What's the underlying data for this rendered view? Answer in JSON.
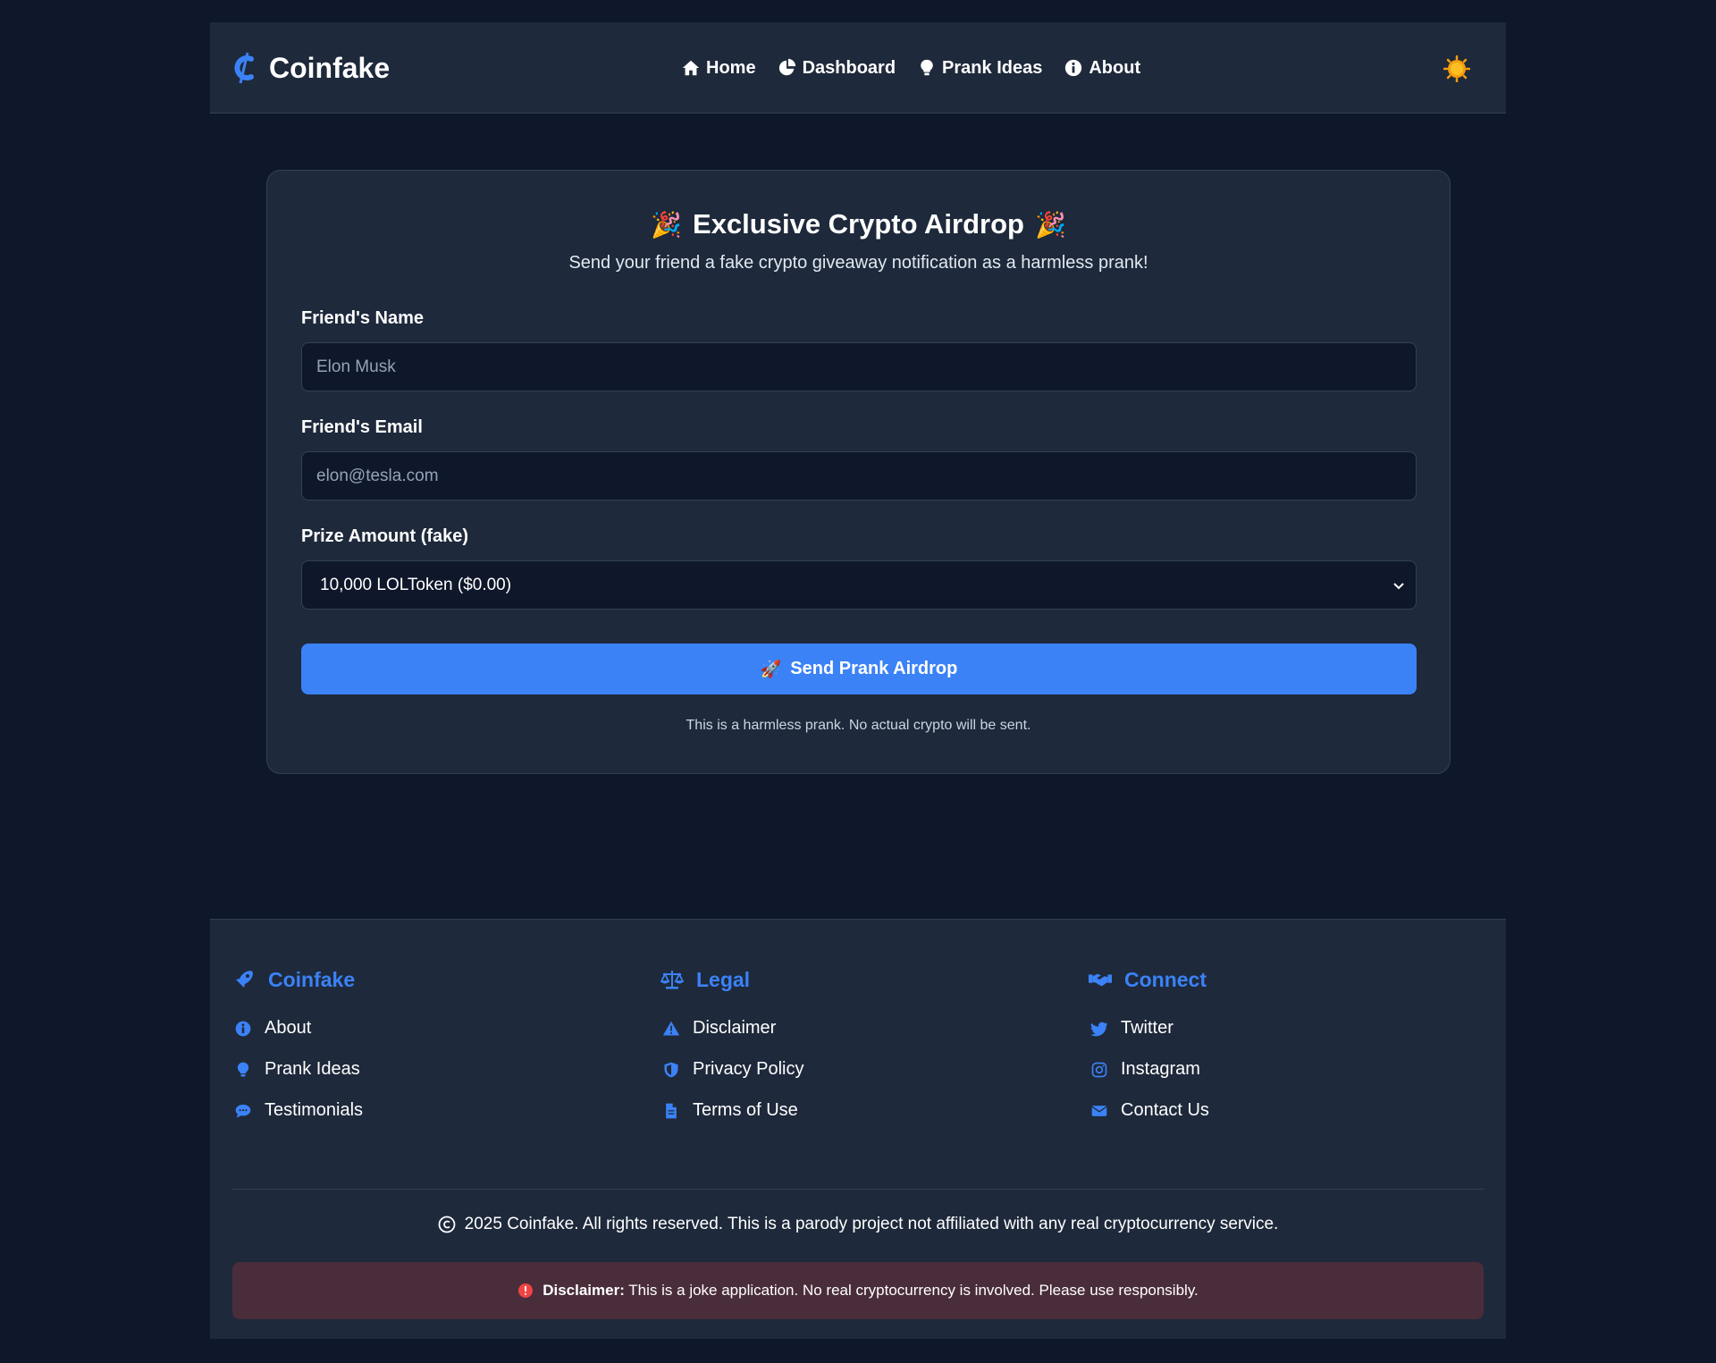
{
  "header": {
    "brand": "Coinfake",
    "nav": [
      {
        "label": "Home",
        "icon": "home-icon"
      },
      {
        "label": "Dashboard",
        "icon": "pie-chart-icon"
      },
      {
        "label": "Prank Ideas",
        "icon": "lightbulb-icon"
      },
      {
        "label": "About",
        "icon": "info-icon"
      }
    ],
    "theme_toggle_icon": "sun-icon"
  },
  "form": {
    "title": "Exclusive Crypto Airdrop",
    "title_emoji": "🎉",
    "subtitle": "Send your friend a fake crypto giveaway notification as a harmless prank!",
    "name_label": "Friend's Name",
    "name_placeholder": "Elon Musk",
    "email_label": "Friend's Email",
    "email_placeholder": "elon@tesla.com",
    "prize_label": "Prize Amount (fake)",
    "prize_selected": "10,000 LOLToken ($0.00)",
    "submit_label": "Send Prank Airdrop",
    "submit_emoji": "🚀",
    "note": "This is a harmless prank. No actual crypto will be sent."
  },
  "footer": {
    "columns": [
      {
        "title": "Coinfake",
        "icon": "rocket-icon",
        "links": [
          {
            "label": "About",
            "icon": "info-icon"
          },
          {
            "label": "Prank Ideas",
            "icon": "lightbulb-icon"
          },
          {
            "label": "Testimonials",
            "icon": "comment-icon"
          }
        ]
      },
      {
        "title": "Legal",
        "icon": "scale-icon",
        "links": [
          {
            "label": "Disclaimer",
            "icon": "warning-icon"
          },
          {
            "label": "Privacy Policy",
            "icon": "shield-icon"
          },
          {
            "label": "Terms of Use",
            "icon": "document-icon"
          }
        ]
      },
      {
        "title": "Connect",
        "icon": "handshake-icon",
        "links": [
          {
            "label": "Twitter",
            "icon": "twitter-icon"
          },
          {
            "label": "Instagram",
            "icon": "instagram-icon"
          },
          {
            "label": "Contact Us",
            "icon": "envelope-icon"
          }
        ]
      }
    ],
    "copyright": "2025 Coinfake. All rights reserved. This is a parody project not affiliated with any real cryptocurrency service.",
    "disclaimer_bold": "Disclaimer:",
    "disclaimer_text": "This is a joke application. No real cryptocurrency is involved. Please use responsibly."
  },
  "colors": {
    "background": "#0f172a",
    "surface": "#1e293b",
    "accent": "#3b82f6",
    "sun": "#f59e0b",
    "danger": "#ef4444",
    "disclaimer_bg": "#4a2d3a"
  }
}
